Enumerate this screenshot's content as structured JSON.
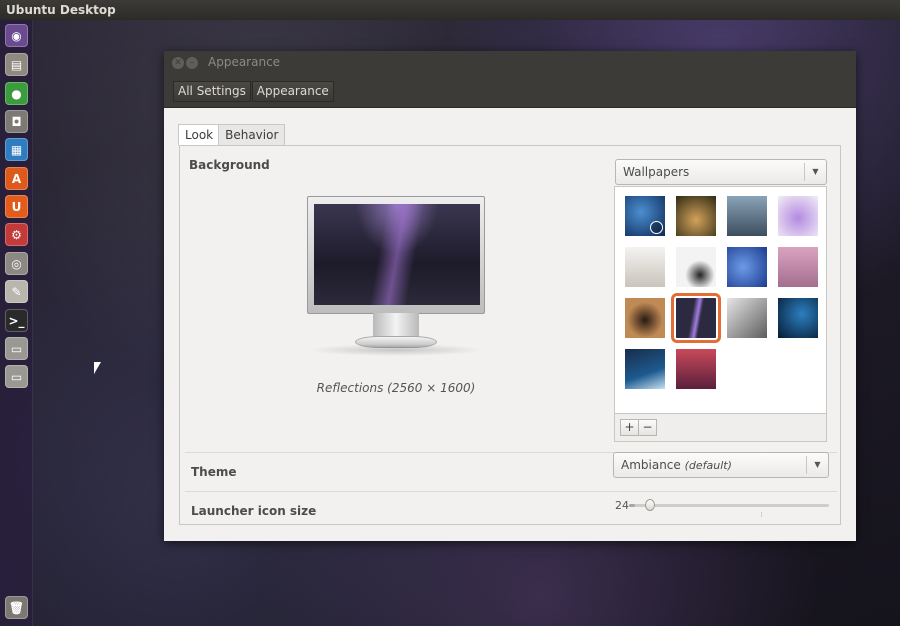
{
  "top_panel": {
    "title": "Ubuntu Desktop"
  },
  "launcher": {
    "items": [
      {
        "name": "dash-icon",
        "glyph": "◉",
        "color": "#6b4b8f"
      },
      {
        "name": "file-manager-icon",
        "glyph": "▤",
        "color": "#8f8a80"
      },
      {
        "name": "chrome-icon",
        "glyph": "●",
        "color": "#3c9b3c"
      },
      {
        "name": "camera-icon",
        "glyph": "◘",
        "color": "#7d7a76"
      },
      {
        "name": "document-viewer-icon",
        "glyph": "▦",
        "color": "#2f7dbf"
      },
      {
        "name": "software-center-icon",
        "glyph": "A",
        "color": "#dd5a1c"
      },
      {
        "name": "ubuntu-one-icon",
        "glyph": "U",
        "color": "#e35c1b"
      },
      {
        "name": "system-settings-icon",
        "glyph": "⚙",
        "color": "#c33a3a"
      },
      {
        "name": "screenshot-icon",
        "glyph": "◎",
        "color": "#8c8984"
      },
      {
        "name": "text-editor-icon",
        "glyph": "✎",
        "color": "#b9b6ae"
      },
      {
        "name": "terminal-icon",
        "glyph": ">_",
        "color": "#2a2a2a"
      },
      {
        "name": "drive-icon",
        "glyph": "▭",
        "color": "#9a9893"
      },
      {
        "name": "drive-2-icon",
        "glyph": "▭",
        "color": "#9a9893"
      },
      {
        "name": "trash-icon",
        "glyph": "🗑",
        "color": "#7a7873"
      }
    ]
  },
  "window": {
    "title": "Appearance",
    "breadcrumbs": [
      "All Settings",
      "Appearance"
    ],
    "tabs": [
      "Look",
      "Behavior"
    ],
    "background_label": "Background",
    "wallpaper_caption": "Reflections (2560 × 1600)",
    "wallpaper_source": "Wallpapers",
    "add_label": "+",
    "remove_label": "−",
    "theme_label": "Theme",
    "theme_value": "Ambiance",
    "theme_default": "(default)",
    "icon_size_label": "Launcher icon size",
    "icon_size_value": "24",
    "icon_size_fraction": 0.1
  },
  "thumbnails": [
    {
      "name": "wallpaper-thumb-1",
      "bg": "radial-gradient(circle at 40% 40%, #4b8fd0, #0d2a5a)",
      "clock": true
    },
    {
      "name": "wallpaper-thumb-2",
      "bg": "radial-gradient(circle at 50% 60%, #d3a25a, #2e2a14)"
    },
    {
      "name": "wallpaper-thumb-3",
      "bg": "linear-gradient(#8aa3b8, #3c4e5e)"
    },
    {
      "name": "wallpaper-thumb-4",
      "bg": "radial-gradient(circle at 50% 55%, #b48ae0, #f2eef7)"
    },
    {
      "name": "wallpaper-thumb-5",
      "bg": "linear-gradient(#f4f3f1, #c9c4bb)"
    },
    {
      "name": "wallpaper-thumb-6",
      "bg": "radial-gradient(circle at 60% 70%, #222, #f3f3f3 40%)"
    },
    {
      "name": "wallpaper-thumb-7",
      "bg": "radial-gradient(circle at 40% 50%, #6d9be8, #1c3b8e)"
    },
    {
      "name": "wallpaper-thumb-8",
      "bg": "linear-gradient(#d9a3c0, #a46f8f)"
    },
    {
      "name": "wallpaper-thumb-9",
      "bg": "radial-gradient(circle at 50% 55%, #2a1a10, #c08a55 60%)"
    },
    {
      "name": "wallpaper-thumb-10",
      "bg": "linear-gradient(100deg, #2b2a40 40%, #a27de0 52%, #2b2a40 60%)",
      "selected": true
    },
    {
      "name": "wallpaper-thumb-11",
      "bg": "linear-gradient(135deg, #e6e6e6, #5d5d5d)"
    },
    {
      "name": "wallpaper-thumb-12",
      "bg": "radial-gradient(circle at 60% 40%, #2b7fbf, #061a33)"
    },
    {
      "name": "wallpaper-thumb-13",
      "bg": "linear-gradient(160deg, #1a2c4a, #1c5a8f 60%, #c7e0f2)"
    },
    {
      "name": "wallpaper-thumb-14",
      "bg": "linear-gradient(#c84a5a, #5a1f3c)"
    }
  ],
  "colors": {
    "accent": "#e36d34",
    "titlebar": "#3c3b37"
  }
}
